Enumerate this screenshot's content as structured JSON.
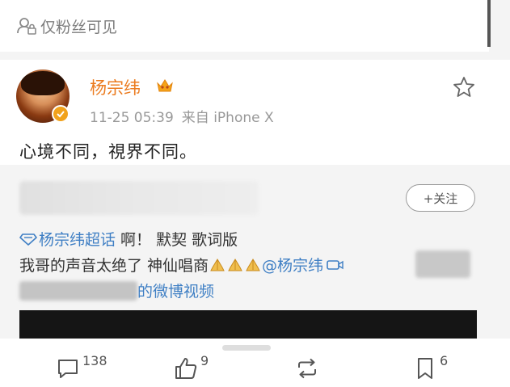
{
  "visibility": {
    "label": "仅粉丝可见"
  },
  "post": {
    "author": "杨宗纬",
    "timestamp": "11-25 05:39",
    "source": "来自 iPhone X",
    "text": "心境不同，視界不同。"
  },
  "repost": {
    "follow_label": "+关注",
    "supertopic": "杨宗纬超话",
    "line1_rest": " 啊！ 默契 歌词版",
    "line2_text": "我哥的声音太绝了 神仙唱商",
    "mention": "@杨宗纬",
    "video_link": "的微博视频"
  },
  "actions": {
    "comments": "138",
    "likes": "9",
    "saves": "6"
  },
  "colors": {
    "username": "#eb7b1f",
    "link": "#3f7fc4",
    "badge": "#f1a21c"
  }
}
